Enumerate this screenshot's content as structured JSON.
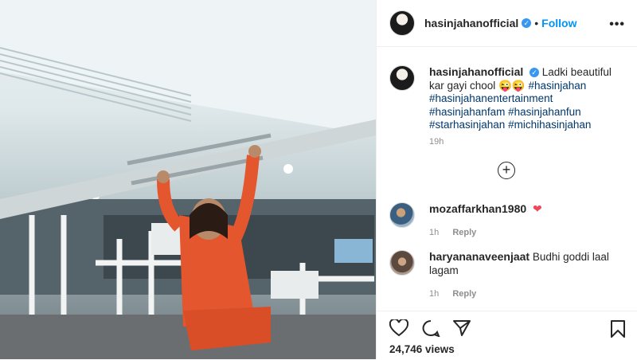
{
  "post": {
    "username": "hasinjahanofficial",
    "verified_glyph": "✓",
    "separator": "•",
    "follow_label": "Follow",
    "more_glyph": "•••"
  },
  "caption": {
    "username": "hasinjahanofficial",
    "text": "Ladki beautiful kar gayi chool 😜😜",
    "hashtags": [
      "#hasinjahan",
      "#hasinjahanentertainment",
      "#hasinjahanfam",
      "#hasinjahanfun",
      "#starhasinjahan",
      "#michihasinjahan"
    ],
    "time": "19h"
  },
  "load_more": {
    "glyph": "+"
  },
  "comments": [
    {
      "username": "mozaffarkhan1980",
      "text": "",
      "emoji": "❤",
      "time": "1h",
      "reply_label": "Reply"
    },
    {
      "username": "haryananaveenjaat",
      "text": "Budhi goddi laal lagam",
      "emoji": "",
      "time": "1h",
      "reply_label": "Reply"
    }
  ],
  "stats": {
    "views": "24,746 views"
  },
  "icons": [
    "heart-icon",
    "comment-icon",
    "share-icon",
    "bookmark-icon",
    "verified-icon",
    "more-options-icon",
    "load-more-icon"
  ],
  "colors": {
    "link": "#0095f6",
    "hashtag": "#00376b",
    "muted": "#8e8e8e",
    "heart": "#ed4956",
    "verified": "#3897f0"
  }
}
